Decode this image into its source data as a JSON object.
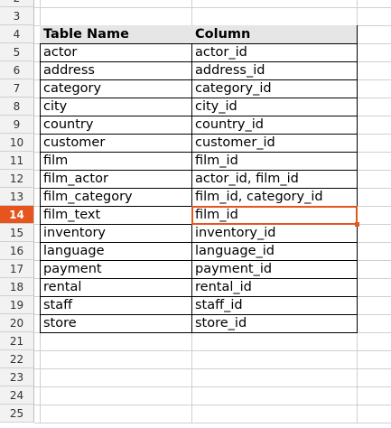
{
  "rows": [
    {
      "num": "2",
      "a": "",
      "b": ""
    },
    {
      "num": "3",
      "a": "",
      "b": ""
    },
    {
      "num": "4",
      "a": "Table Name",
      "b": "Column",
      "header": true
    },
    {
      "num": "5",
      "a": "actor",
      "b": "actor_id"
    },
    {
      "num": "6",
      "a": "address",
      "b": "address_id"
    },
    {
      "num": "7",
      "a": "category",
      "b": "category_id"
    },
    {
      "num": "8",
      "a": "city",
      "b": "city_id"
    },
    {
      "num": "9",
      "a": "country",
      "b": "country_id"
    },
    {
      "num": "10",
      "a": "customer",
      "b": "customer_id"
    },
    {
      "num": "11",
      "a": "film",
      "b": "film_id"
    },
    {
      "num": "12",
      "a": "film_actor",
      "b": "actor_id, film_id"
    },
    {
      "num": "13",
      "a": "film_category",
      "b": "film_id, category_id"
    },
    {
      "num": "14",
      "a": "film_text",
      "b": "film_id",
      "active": true
    },
    {
      "num": "15",
      "a": "inventory",
      "b": "inventory_id"
    },
    {
      "num": "16",
      "a": "language",
      "b": "language_id"
    },
    {
      "num": "17",
      "a": "payment",
      "b": "payment_id"
    },
    {
      "num": "18",
      "a": "rental",
      "b": "rental_id"
    },
    {
      "num": "19",
      "a": "staff",
      "b": "staff_id"
    },
    {
      "num": "20",
      "a": "store",
      "b": "store_id"
    },
    {
      "num": "21",
      "a": "",
      "b": ""
    },
    {
      "num": "22",
      "a": "",
      "b": ""
    },
    {
      "num": "23",
      "a": "",
      "b": ""
    },
    {
      "num": "24",
      "a": "",
      "b": ""
    },
    {
      "num": "25",
      "a": "",
      "b": ""
    }
  ],
  "colors": {
    "accent": "#e6551e",
    "header_bg": "#f2f2f2",
    "table_header_bg": "#e6e6e6",
    "grid": "#d0d0d0"
  }
}
